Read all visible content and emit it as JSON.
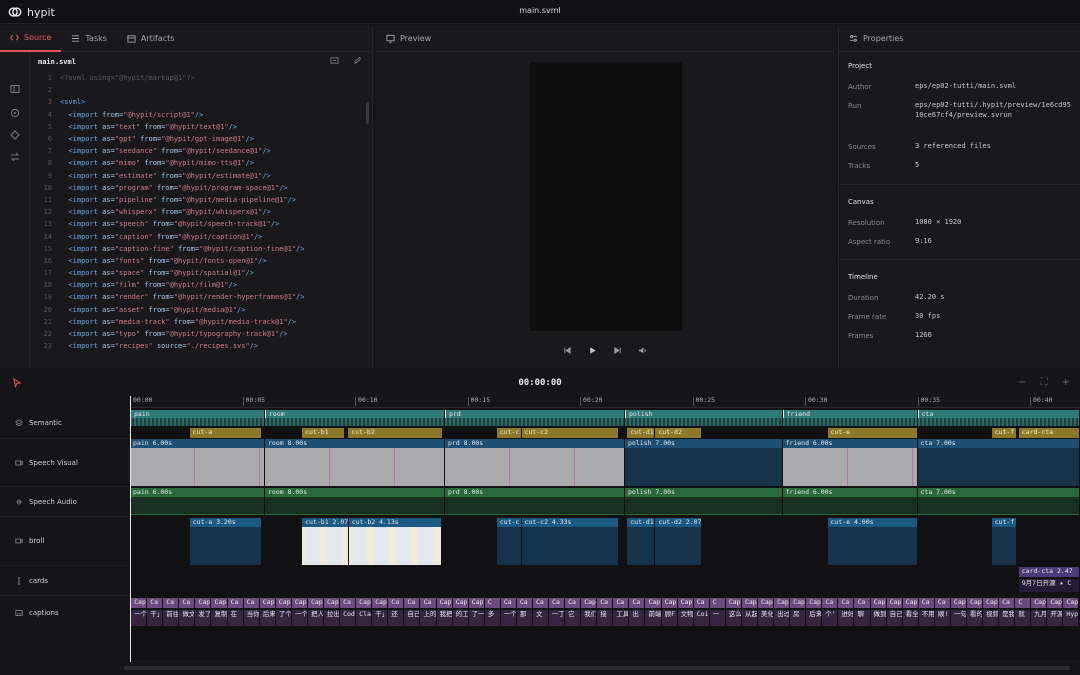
{
  "app": {
    "name": "hypit",
    "file": "main.svml"
  },
  "tabs": [
    {
      "label": "Source",
      "icon": "code-icon",
      "active": true
    },
    {
      "label": "Tasks",
      "icon": "list-icon",
      "active": false
    },
    {
      "label": "Artifacts",
      "icon": "box-icon",
      "active": false
    }
  ],
  "preview_label": "Preview",
  "properties_label": "Properties",
  "editor": {
    "filename": "main.svml"
  },
  "code": [
    {
      "n": "1",
      "parts": [
        [
          "cmt",
          "<?svml using=\"@hypit/markup@1\"?>"
        ]
      ]
    },
    {
      "n": "2",
      "parts": []
    },
    {
      "n": "3",
      "parts": [
        [
          "tag",
          "<svml>"
        ]
      ]
    },
    {
      "n": "4",
      "parts": [
        [
          "tag",
          "  <import "
        ],
        [
          "att",
          "from="
        ],
        [
          "str",
          "\"@hypit/script@1\""
        ],
        [
          "tag",
          "/>"
        ]
      ]
    },
    {
      "n": "5",
      "parts": [
        [
          "tag",
          "  <import "
        ],
        [
          "att",
          "as="
        ],
        [
          "str",
          "\"text\" "
        ],
        [
          "att",
          "from="
        ],
        [
          "str",
          "\"@hypit/text@1\""
        ],
        [
          "tag",
          "/>"
        ]
      ]
    },
    {
      "n": "6",
      "parts": [
        [
          "tag",
          "  <import "
        ],
        [
          "att",
          "as="
        ],
        [
          "str",
          "\"gpt\" "
        ],
        [
          "att",
          "from="
        ],
        [
          "str",
          "\"@hypit/gpt-image@1\""
        ],
        [
          "tag",
          "/>"
        ]
      ]
    },
    {
      "n": "7",
      "parts": [
        [
          "tag",
          "  <import "
        ],
        [
          "att",
          "as="
        ],
        [
          "str",
          "\"seedance\" "
        ],
        [
          "att",
          "from="
        ],
        [
          "str",
          "\"@hypit/seedance@1\""
        ],
        [
          "tag",
          "/>"
        ]
      ]
    },
    {
      "n": "8",
      "parts": [
        [
          "tag",
          "  <import "
        ],
        [
          "att",
          "as="
        ],
        [
          "str",
          "\"mimo\" "
        ],
        [
          "att",
          "from="
        ],
        [
          "str",
          "\"@hypit/mimo-tts@1\""
        ],
        [
          "tag",
          "/>"
        ]
      ]
    },
    {
      "n": "9",
      "parts": [
        [
          "tag",
          "  <import "
        ],
        [
          "att",
          "as="
        ],
        [
          "str",
          "\"estimate\" "
        ],
        [
          "att",
          "from="
        ],
        [
          "str",
          "\"@hypit/estimate@1\""
        ],
        [
          "tag",
          "/>"
        ]
      ]
    },
    {
      "n": "10",
      "parts": [
        [
          "tag",
          "  <import "
        ],
        [
          "att",
          "as="
        ],
        [
          "str",
          "\"program\" "
        ],
        [
          "att",
          "from="
        ],
        [
          "str",
          "\"@hypit/program-space@1\""
        ],
        [
          "tag",
          "/>"
        ]
      ]
    },
    {
      "n": "11",
      "parts": [
        [
          "tag",
          "  <import "
        ],
        [
          "att",
          "as="
        ],
        [
          "str",
          "\"pipeline\" "
        ],
        [
          "att",
          "from="
        ],
        [
          "str",
          "\"@hypit/media-pipeline@1\""
        ],
        [
          "tag",
          "/>"
        ]
      ]
    },
    {
      "n": "12",
      "parts": [
        [
          "tag",
          "  <import "
        ],
        [
          "att",
          "as="
        ],
        [
          "str",
          "\"whisperx\" "
        ],
        [
          "att",
          "from="
        ],
        [
          "str",
          "\"@hypit/whisperx@1\""
        ],
        [
          "tag",
          "/>"
        ]
      ]
    },
    {
      "n": "13",
      "parts": [
        [
          "tag",
          "  <import "
        ],
        [
          "att",
          "as="
        ],
        [
          "str",
          "\"speech\" "
        ],
        [
          "att",
          "from="
        ],
        [
          "str",
          "\"@hypit/speech-track@1\""
        ],
        [
          "tag",
          "/>"
        ]
      ]
    },
    {
      "n": "14",
      "parts": [
        [
          "tag",
          "  <import "
        ],
        [
          "att",
          "as="
        ],
        [
          "str",
          "\"caption\" "
        ],
        [
          "att",
          "from="
        ],
        [
          "str",
          "\"@hypit/caption@1\""
        ],
        [
          "tag",
          "/>"
        ]
      ]
    },
    {
      "n": "15",
      "parts": [
        [
          "tag",
          "  <import "
        ],
        [
          "att",
          "as="
        ],
        [
          "str",
          "\"caption-fine\" "
        ],
        [
          "att",
          "from="
        ],
        [
          "str",
          "\"@hypit/caption-fine@1\""
        ],
        [
          "tag",
          "/>"
        ]
      ]
    },
    {
      "n": "16",
      "parts": [
        [
          "tag",
          "  <import "
        ],
        [
          "att",
          "as="
        ],
        [
          "str",
          "\"fonts\" "
        ],
        [
          "att",
          "from="
        ],
        [
          "str",
          "\"@hypit/fonts-open@1\""
        ],
        [
          "tag",
          "/>"
        ]
      ]
    },
    {
      "n": "17",
      "parts": [
        [
          "tag",
          "  <import "
        ],
        [
          "att",
          "as="
        ],
        [
          "str",
          "\"space\" "
        ],
        [
          "att",
          "from="
        ],
        [
          "str",
          "\"@hypit/spatial@1\""
        ],
        [
          "tag",
          "/>"
        ]
      ]
    },
    {
      "n": "18",
      "parts": [
        [
          "tag",
          "  <import "
        ],
        [
          "att",
          "as="
        ],
        [
          "str",
          "\"film\" "
        ],
        [
          "att",
          "from="
        ],
        [
          "str",
          "\"@hypit/film@1\""
        ],
        [
          "tag",
          "/>"
        ]
      ]
    },
    {
      "n": "19",
      "parts": [
        [
          "tag",
          "  <import "
        ],
        [
          "att",
          "as="
        ],
        [
          "str",
          "\"render\" "
        ],
        [
          "att",
          "from="
        ],
        [
          "str",
          "\"@hypit/render-hyperframes@1\""
        ],
        [
          "tag",
          "/>"
        ]
      ]
    },
    {
      "n": "20",
      "parts": [
        [
          "tag",
          "  <import "
        ],
        [
          "att",
          "as="
        ],
        [
          "str",
          "\"asset\" "
        ],
        [
          "att",
          "from="
        ],
        [
          "str",
          "\"@hypit/media@1\""
        ],
        [
          "tag",
          "/>"
        ]
      ]
    },
    {
      "n": "21",
      "parts": [
        [
          "tag",
          "  <import "
        ],
        [
          "att",
          "as="
        ],
        [
          "str",
          "\"media-track\" "
        ],
        [
          "att",
          "from="
        ],
        [
          "str",
          "\"@hypit/media-track@1\""
        ],
        [
          "tag",
          "/>"
        ]
      ]
    },
    {
      "n": "22",
      "parts": [
        [
          "tag",
          "  <import "
        ],
        [
          "att",
          "as="
        ],
        [
          "str",
          "\"typo\" "
        ],
        [
          "att",
          "from="
        ],
        [
          "str",
          "\"@hypit/typography-track@1\""
        ],
        [
          "tag",
          "/>"
        ]
      ]
    },
    {
      "n": "23",
      "parts": [
        [
          "tag",
          "  <import "
        ],
        [
          "att",
          "as="
        ],
        [
          "str",
          "\"recipes\" "
        ],
        [
          "att",
          "source="
        ],
        [
          "str",
          "\"./recipes.svs\""
        ],
        [
          "tag",
          "/>"
        ]
      ]
    }
  ],
  "properties": {
    "project": {
      "heading": "Project",
      "rows": [
        {
          "k": "Author",
          "v": "eps/ep02-tutti/main.svml"
        },
        {
          "k": "Run",
          "v": "eps/ep02-tutti/.hypit/preview/1e6cd9510ce67cf4/preview.svrun"
        },
        {
          "k": "Sources",
          "v": "3 referenced files"
        },
        {
          "k": "Tracks",
          "v": "5"
        }
      ]
    },
    "canvas": {
      "heading": "Canvas",
      "rows": [
        {
          "k": "Resolution",
          "v": "1080 × 1920"
        },
        {
          "k": "Aspect ratio",
          "v": "9:16"
        }
      ]
    },
    "timeline": {
      "heading": "Timeline",
      "rows": [
        {
          "k": "Duration",
          "v": "42.20 s"
        },
        {
          "k": "Frame rate",
          "v": "30 fps"
        },
        {
          "k": "Frames",
          "v": "1266"
        }
      ]
    }
  },
  "timeline": {
    "timecode": "00:00:00",
    "ruler": [
      "00:00",
      "00:05",
      "00:10",
      "00:15",
      "00:20",
      "00:25",
      "00:30",
      "00:35",
      "00:40"
    ],
    "tracks": [
      "Semantic",
      "Speech Visual",
      "Speech Audio",
      "broll",
      "cards",
      "captions"
    ],
    "semantic": [
      {
        "label": "pain",
        "start": 0,
        "end": 6
      },
      {
        "label": "room",
        "start": 6,
        "end": 14
      },
      {
        "label": "prd",
        "start": 14,
        "end": 22
      },
      {
        "label": "polish",
        "start": 22,
        "end": 29
      },
      {
        "label": "friend",
        "start": 29,
        "end": 35
      },
      {
        "label": "cta",
        "start": 35,
        "end": 42.2
      }
    ],
    "cuts": [
      {
        "label": "cut-a",
        "start": 2.65,
        "end": 5.85
      },
      {
        "label": "cut-b1",
        "start": 7.65,
        "end": 9.55
      },
      {
        "label": "cut-b2",
        "start": 9.7,
        "end": 13.9
      },
      {
        "label": "cut-c",
        "start": 16.3,
        "end": 17.4
      },
      {
        "label": "cut-c2",
        "start": 17.4,
        "end": 21.75
      },
      {
        "label": "cut-d1",
        "start": 22.1,
        "end": 23.35
      },
      {
        "label": "cut-d2",
        "start": 23.35,
        "end": 25.4
      },
      {
        "label": "cut-e",
        "start": 31.0,
        "end": 35.0
      },
      {
        "label": "cut-f",
        "start": 38.3,
        "end": 39.4
      },
      {
        "label": "card-cta",
        "start": 39.5,
        "end": 42.2
      }
    ],
    "speech_visual": [
      {
        "label": "pain 6.00s",
        "start": 0,
        "end": 6,
        "filled": true
      },
      {
        "label": "room 8.00s",
        "start": 6,
        "end": 14,
        "filled": true
      },
      {
        "label": "prd 8.00s",
        "start": 14,
        "end": 22,
        "filled": true
      },
      {
        "label": "polish 7.00s",
        "start": 22,
        "end": 29,
        "filled": false
      },
      {
        "label": "friend 6.00s",
        "start": 29,
        "end": 35,
        "filled": true
      },
      {
        "label": "cta 7.00s",
        "start": 35,
        "end": 42.2,
        "filled": false
      }
    ],
    "speech_audio": [
      {
        "label": "pain 6.00s",
        "start": 0,
        "end": 6
      },
      {
        "label": "room 8.00s",
        "start": 6,
        "end": 14
      },
      {
        "label": "prd 8.00s",
        "start": 14,
        "end": 22
      },
      {
        "label": "polish 7.00s",
        "start": 22,
        "end": 29
      },
      {
        "label": "friend 6.00s",
        "start": 29,
        "end": 35
      },
      {
        "label": "cta 7.00s",
        "start": 35,
        "end": 42.2
      }
    ],
    "broll": [
      {
        "label": "cut-a 3.20s",
        "start": 2.65,
        "end": 5.85,
        "thumbs": false
      },
      {
        "label": "cut-b1 2.07",
        "start": 7.65,
        "end": 9.72,
        "thumbs": true
      },
      {
        "label": "cut-b2 4.13s",
        "start": 9.72,
        "end": 13.85,
        "thumbs": true
      },
      {
        "label": "cut-c",
        "start": 16.3,
        "end": 17.4,
        "thumbs": false
      },
      {
        "label": "cut-c2 4.33s",
        "start": 17.4,
        "end": 21.75,
        "thumbs": false
      },
      {
        "label": "cut-d1",
        "start": 22.1,
        "end": 23.35,
        "thumbs": false
      },
      {
        "label": "cut-d2 2.07",
        "start": 23.35,
        "end": 25.4,
        "thumbs": false
      },
      {
        "label": "cut-e 4.00s",
        "start": 31.0,
        "end": 35.0,
        "thumbs": false
      },
      {
        "label": "cut-f 1",
        "start": 38.3,
        "end": 39.4,
        "thumbs": false
      }
    ],
    "cards": [
      {
        "label": "card-cta 2.47",
        "sub": "9月7日开源 ★ C",
        "start": 39.5,
        "end": 42.2
      }
    ],
    "captions_top": [
      "Capt",
      "Ca",
      "Ca",
      "Ca",
      "Cap",
      "Cap",
      "Ca",
      "Ca",
      "Capt",
      "Cap",
      "Cap",
      "Cap",
      "Cap",
      "Ca",
      "Capt",
      "Capt",
      "Ca",
      "Ca",
      "Ca",
      "Capt",
      "Cap",
      "Capt",
      "C",
      "Ca",
      "Ca",
      "Ca",
      "Ca",
      "Ca",
      "Cap",
      "Ca",
      "Ca",
      "Ca",
      "Cap",
      "Cap",
      "Cap",
      "Ca",
      "C",
      "Cap",
      "Capt",
      "Capt",
      "Cap",
      "Cap",
      "Cap",
      "Ca",
      "Ca",
      "Ca",
      "Cap",
      "Cap",
      "Capti",
      "Ca",
      "Ca",
      "Cap",
      "Cap",
      "Cap",
      "Ca",
      "C",
      "Cap",
      "Cap",
      "Captio"
    ],
    "captions_bottom": [
      "一个。几'",
      "干」",
      "前往",
      "做文",
      "发了",
      "复制",
      "在",
      "当你'",
      "后来",
      "了个",
      "一个",
      "把人",
      "拉出",
      "Codi",
      "Clau",
      "干」",
      "还",
      "自己",
      "上的",
      "我把",
      "的工",
      "了一",
      "多",
      "一个",
      "那",
      "文",
      "一丁",
      "它",
      "我们",
      "接",
      "工具",
      "出",
      "前端",
      "顾F",
      "文物",
      "Coi",
      "一",
      "这么",
      "从起",
      "美化",
      "出过",
      "房",
      "后来",
      "个''",
      "进好",
      "聊",
      "做到",
      "自己",
      "看全",
      "不用",
      "顺!",
      "一句",
      "看的",
      "视频",
      "是我",
      "就",
      "九月",
      "开源",
      "Hypit"
    ]
  }
}
